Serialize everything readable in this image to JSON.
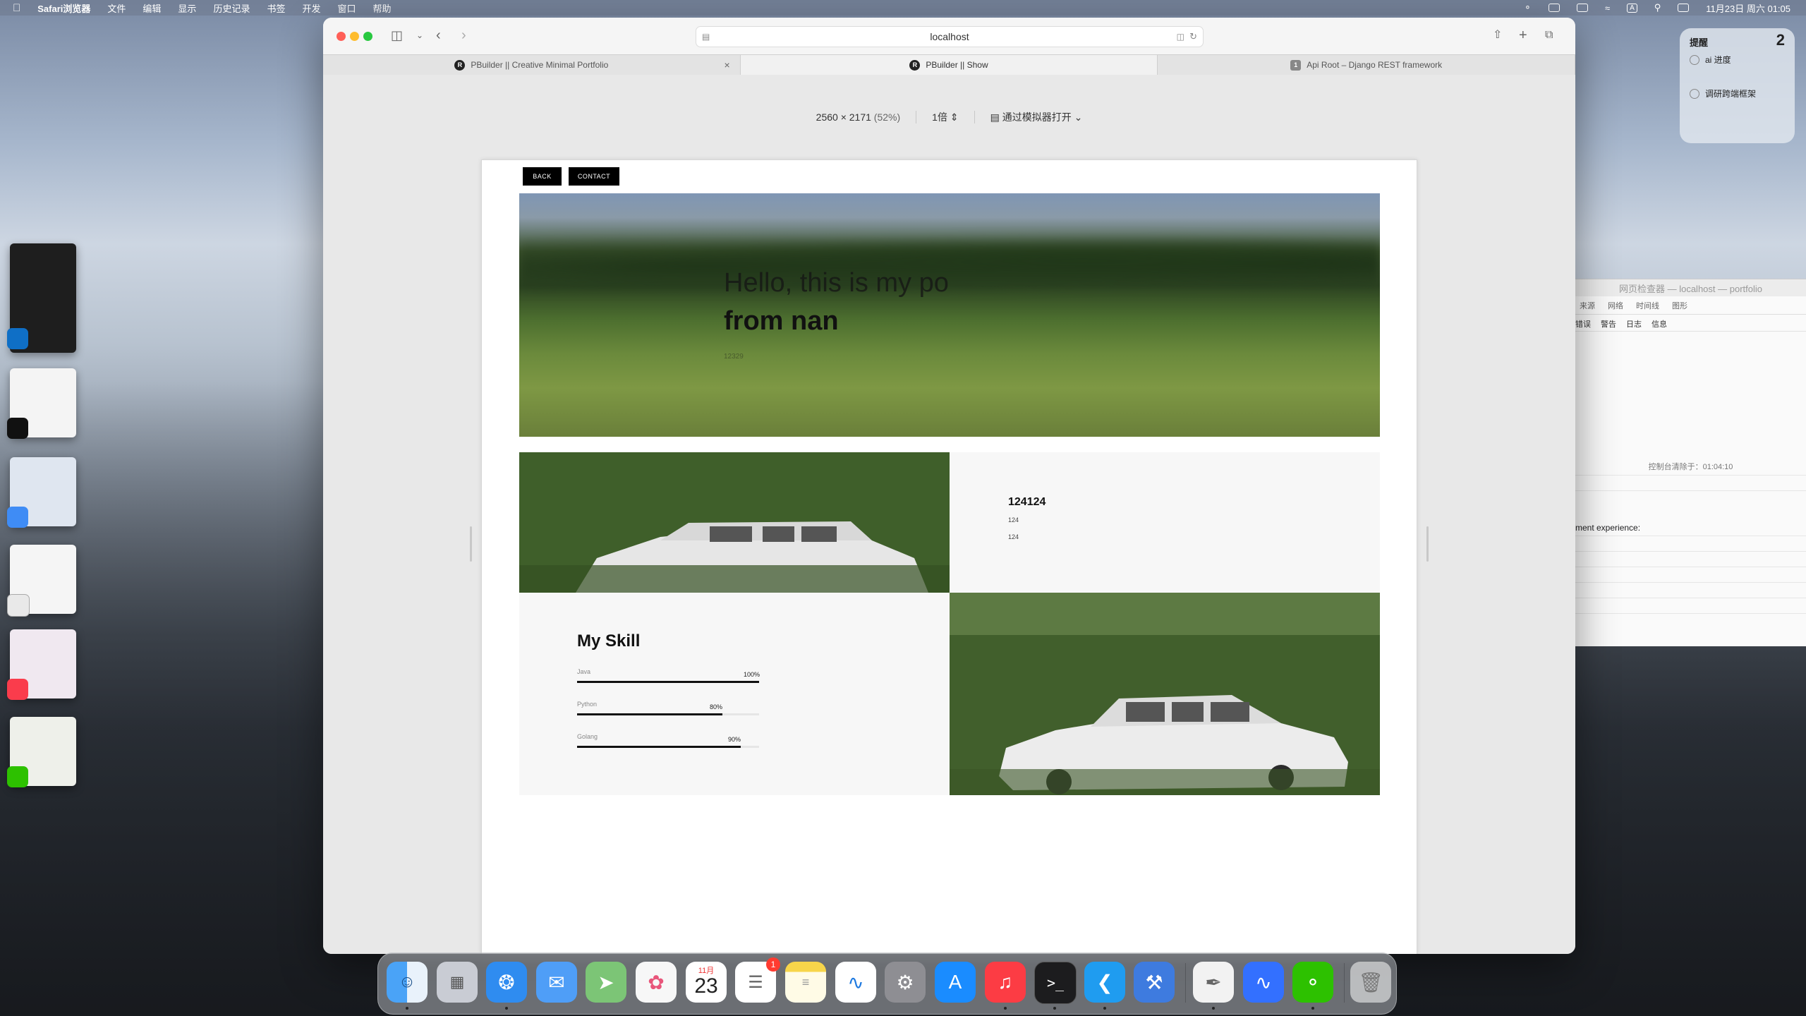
{
  "menubar": {
    "app_name": "Safari浏览器",
    "menus": [
      "文件",
      "编辑",
      "显示",
      "历史记录",
      "书签",
      "开发",
      "窗口",
      "帮助"
    ],
    "datetime": "11月23日 周六 01:05"
  },
  "safari": {
    "address": "localhost",
    "tabs": [
      {
        "title": "PBuilder || Creative Minimal Portfolio",
        "favicon": "R"
      },
      {
        "title": "PBuilder || Show",
        "favicon": "R"
      },
      {
        "title": "Api Root – Django REST framework",
        "favicon": "1"
      }
    ],
    "responsive_bar": {
      "dimensions": "2560 × 2171",
      "percent": "(52%)",
      "scale": "1倍",
      "simulator": "通过模拟器打开"
    }
  },
  "portfolio": {
    "back_label": "BACK",
    "contact_label": "CONTACT",
    "hero_line1": "Hello, this is my po",
    "hero_line2": "from nan",
    "hero_small": "12329",
    "info_title": "124124",
    "info_line1": "124",
    "info_line2": "124",
    "skills_title": "My Skill",
    "skills": [
      {
        "name": "Java",
        "percent": "100%",
        "value": 1.0
      },
      {
        "name": "Python",
        "percent": "80%",
        "value": 0.8
      },
      {
        "name": "Golang",
        "percent": "90%",
        "value": 0.9
      }
    ]
  },
  "reminders": {
    "title": "提醒",
    "count": "2",
    "items": [
      "ai 进度",
      "调研跨端框架"
    ]
  },
  "inspector": {
    "title": "网页检查器 — localhost — portfolio",
    "tabs": [
      "来源",
      "网络",
      "时间线",
      "图形"
    ],
    "filters": [
      "错误",
      "警告",
      "日志",
      "信息"
    ],
    "cleared": "控制台清除于：01:04:10",
    "message": "ment experience:"
  },
  "dock": {
    "calendar_month": "11月",
    "calendar_day": "23",
    "reminders_badge": "1"
  }
}
